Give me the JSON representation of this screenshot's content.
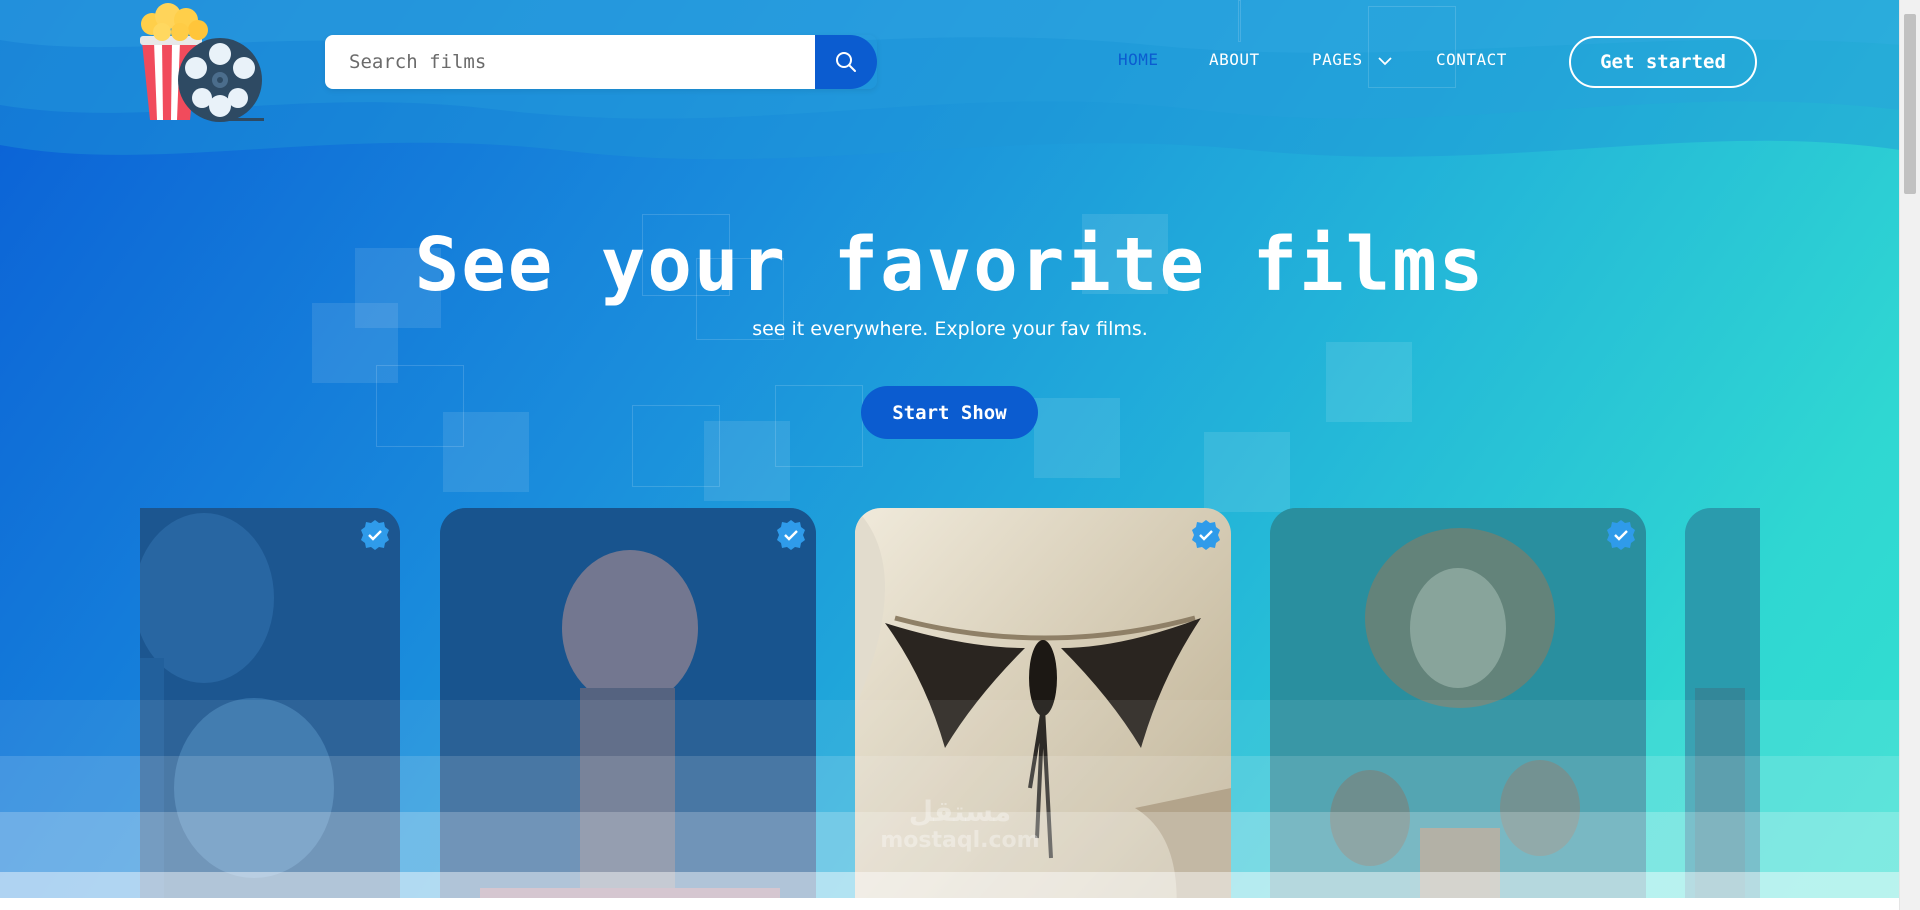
{
  "header": {
    "search": {
      "placeholder": "Search films",
      "value": ""
    },
    "nav": [
      {
        "label": "HOME",
        "active": true
      },
      {
        "label": "ABOUT",
        "active": false
      },
      {
        "label": "PAGES",
        "active": false,
        "has_dropdown": true
      },
      {
        "label": "CONTACT",
        "active": false
      }
    ],
    "cta_label": "Get started"
  },
  "hero": {
    "title": "See your favorite films",
    "subtitle": "see it everywhere. Explore your fav films.",
    "button_label": "Start Show"
  },
  "cards": [
    {
      "name": "poster-action-duo",
      "verified": true,
      "dimmed": true
    },
    {
      "name": "poster-fist",
      "verified": true,
      "dimmed": true
    },
    {
      "name": "poster-moth-eye",
      "verified": true,
      "dimmed": false
    },
    {
      "name": "poster-atlas",
      "verified": true,
      "dimmed": true
    },
    {
      "name": "poster-partial",
      "verified": false,
      "dimmed": true
    }
  ],
  "watermark": {
    "line1": "مستقل",
    "line2": "mostaql.com"
  },
  "colors": {
    "brand_blue": "#0b5cd0",
    "gradient_start": "#0a5fd6",
    "gradient_end": "#33e0d0",
    "verified_badge": "#2f9bea"
  },
  "icons": {
    "logo": "popcorn-film-reel-logo",
    "search": "search-icon",
    "dropdown": "chevron-down-icon",
    "verified": "verified-check-icon"
  }
}
